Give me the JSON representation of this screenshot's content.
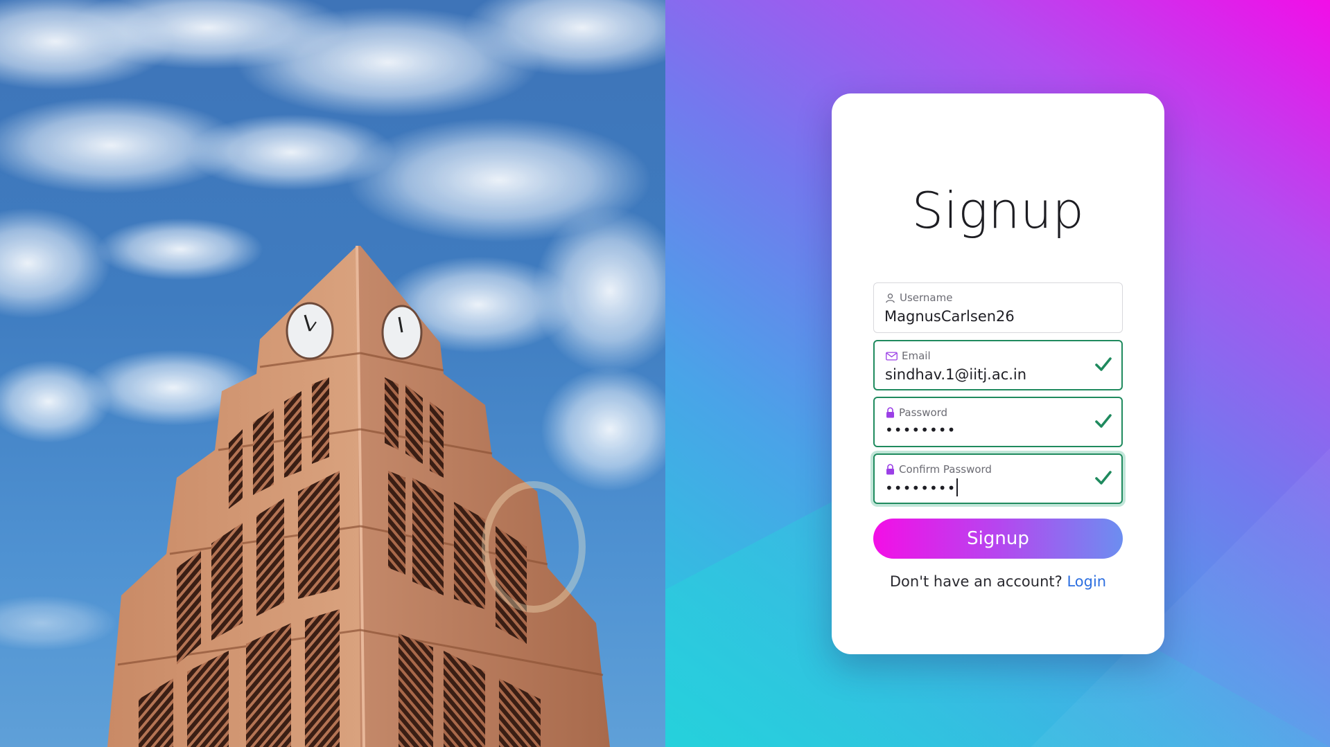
{
  "form": {
    "title": "Signup",
    "fields": [
      {
        "label": "Username",
        "value": "MagnusCarlsen26",
        "icon": "user-icon",
        "status": "default"
      },
      {
        "label": "Email",
        "value": "sindhav.1@iitj.ac.in",
        "icon": "envelope-icon",
        "status": "valid"
      },
      {
        "label": "Password",
        "value": "••••••••",
        "icon": "lock-icon",
        "status": "valid"
      },
      {
        "label": "Confirm Password",
        "value": "••••••••",
        "icon": "lock-icon",
        "status": "valid-focused"
      }
    ],
    "submit_label": "Signup",
    "footer_text": "Don't have an account?",
    "footer_link": "Login"
  },
  "colors": {
    "valid_border": "#1f8a5e",
    "icon_accent": "#9b3fe6",
    "link": "#2d6fe0",
    "button_gradient_start": "#f30fe6",
    "button_gradient_end": "#6c8ef0"
  },
  "images": {
    "left_photo": "clock-tower-under-cloudy-sky"
  }
}
